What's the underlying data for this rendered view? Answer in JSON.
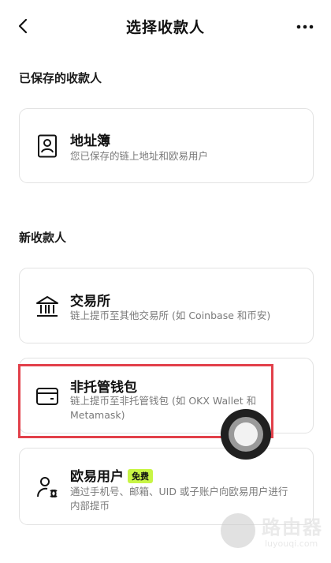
{
  "header": {
    "title": "选择收款人"
  },
  "saved_section": {
    "label": "已保存的收款人",
    "address_book": {
      "title": "地址簿",
      "description": "您已保存的链上地址和欧易用户"
    }
  },
  "new_section": {
    "label": "新收款人",
    "exchange": {
      "title": "交易所",
      "description": "链上提币至其他交易所 (如 Coinbase 和币安)"
    },
    "wallet": {
      "title": "非托管钱包",
      "description": "链上提币至非托管钱包 (如 OKX Wallet 和 Metamask)"
    },
    "okx_user": {
      "title": "欧易用户",
      "badge": "免费",
      "description": "通过手机号、邮箱、UID 或子账户向欧易用户进行内部提币"
    }
  },
  "watermark": {
    "text": "路由器",
    "subtext": "luyouqi.com"
  },
  "colors": {
    "highlight_border": "#e2404a",
    "badge_bg": "#c8f545"
  }
}
